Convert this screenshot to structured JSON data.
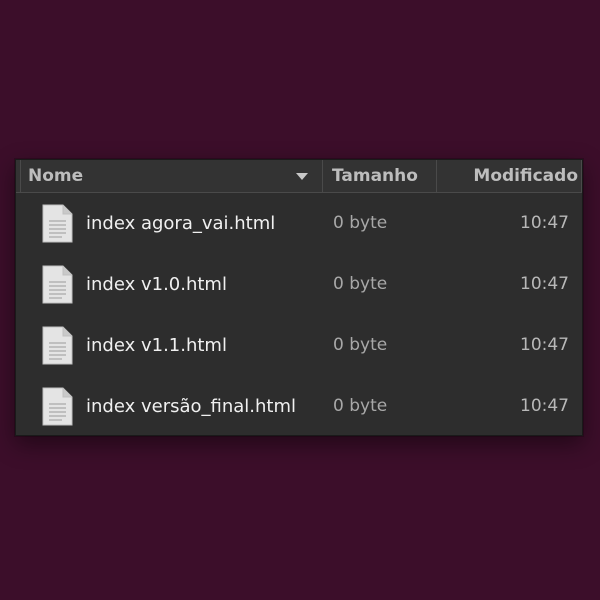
{
  "columns": {
    "name": "Nome",
    "size": "Tamanho",
    "modified": "Modificado",
    "sort_icon": "chevron-down-icon"
  },
  "files": [
    {
      "name": "index agora_vai.html",
      "size": "0 byte",
      "modified": "10:47",
      "icon": "text-file-icon"
    },
    {
      "name": "index v1.0.html",
      "size": "0 byte",
      "modified": "10:47",
      "icon": "text-file-icon"
    },
    {
      "name": "index v1.1.html",
      "size": "0 byte",
      "modified": "10:47",
      "icon": "text-file-icon"
    },
    {
      "name": "index versão_final.html",
      "size": "0 byte",
      "modified": "10:47",
      "icon": "text-file-icon"
    }
  ],
  "colors": {
    "desktop_background": "#3c0e2a",
    "panel_background": "#2d2d2d",
    "header_background": "#333333"
  }
}
